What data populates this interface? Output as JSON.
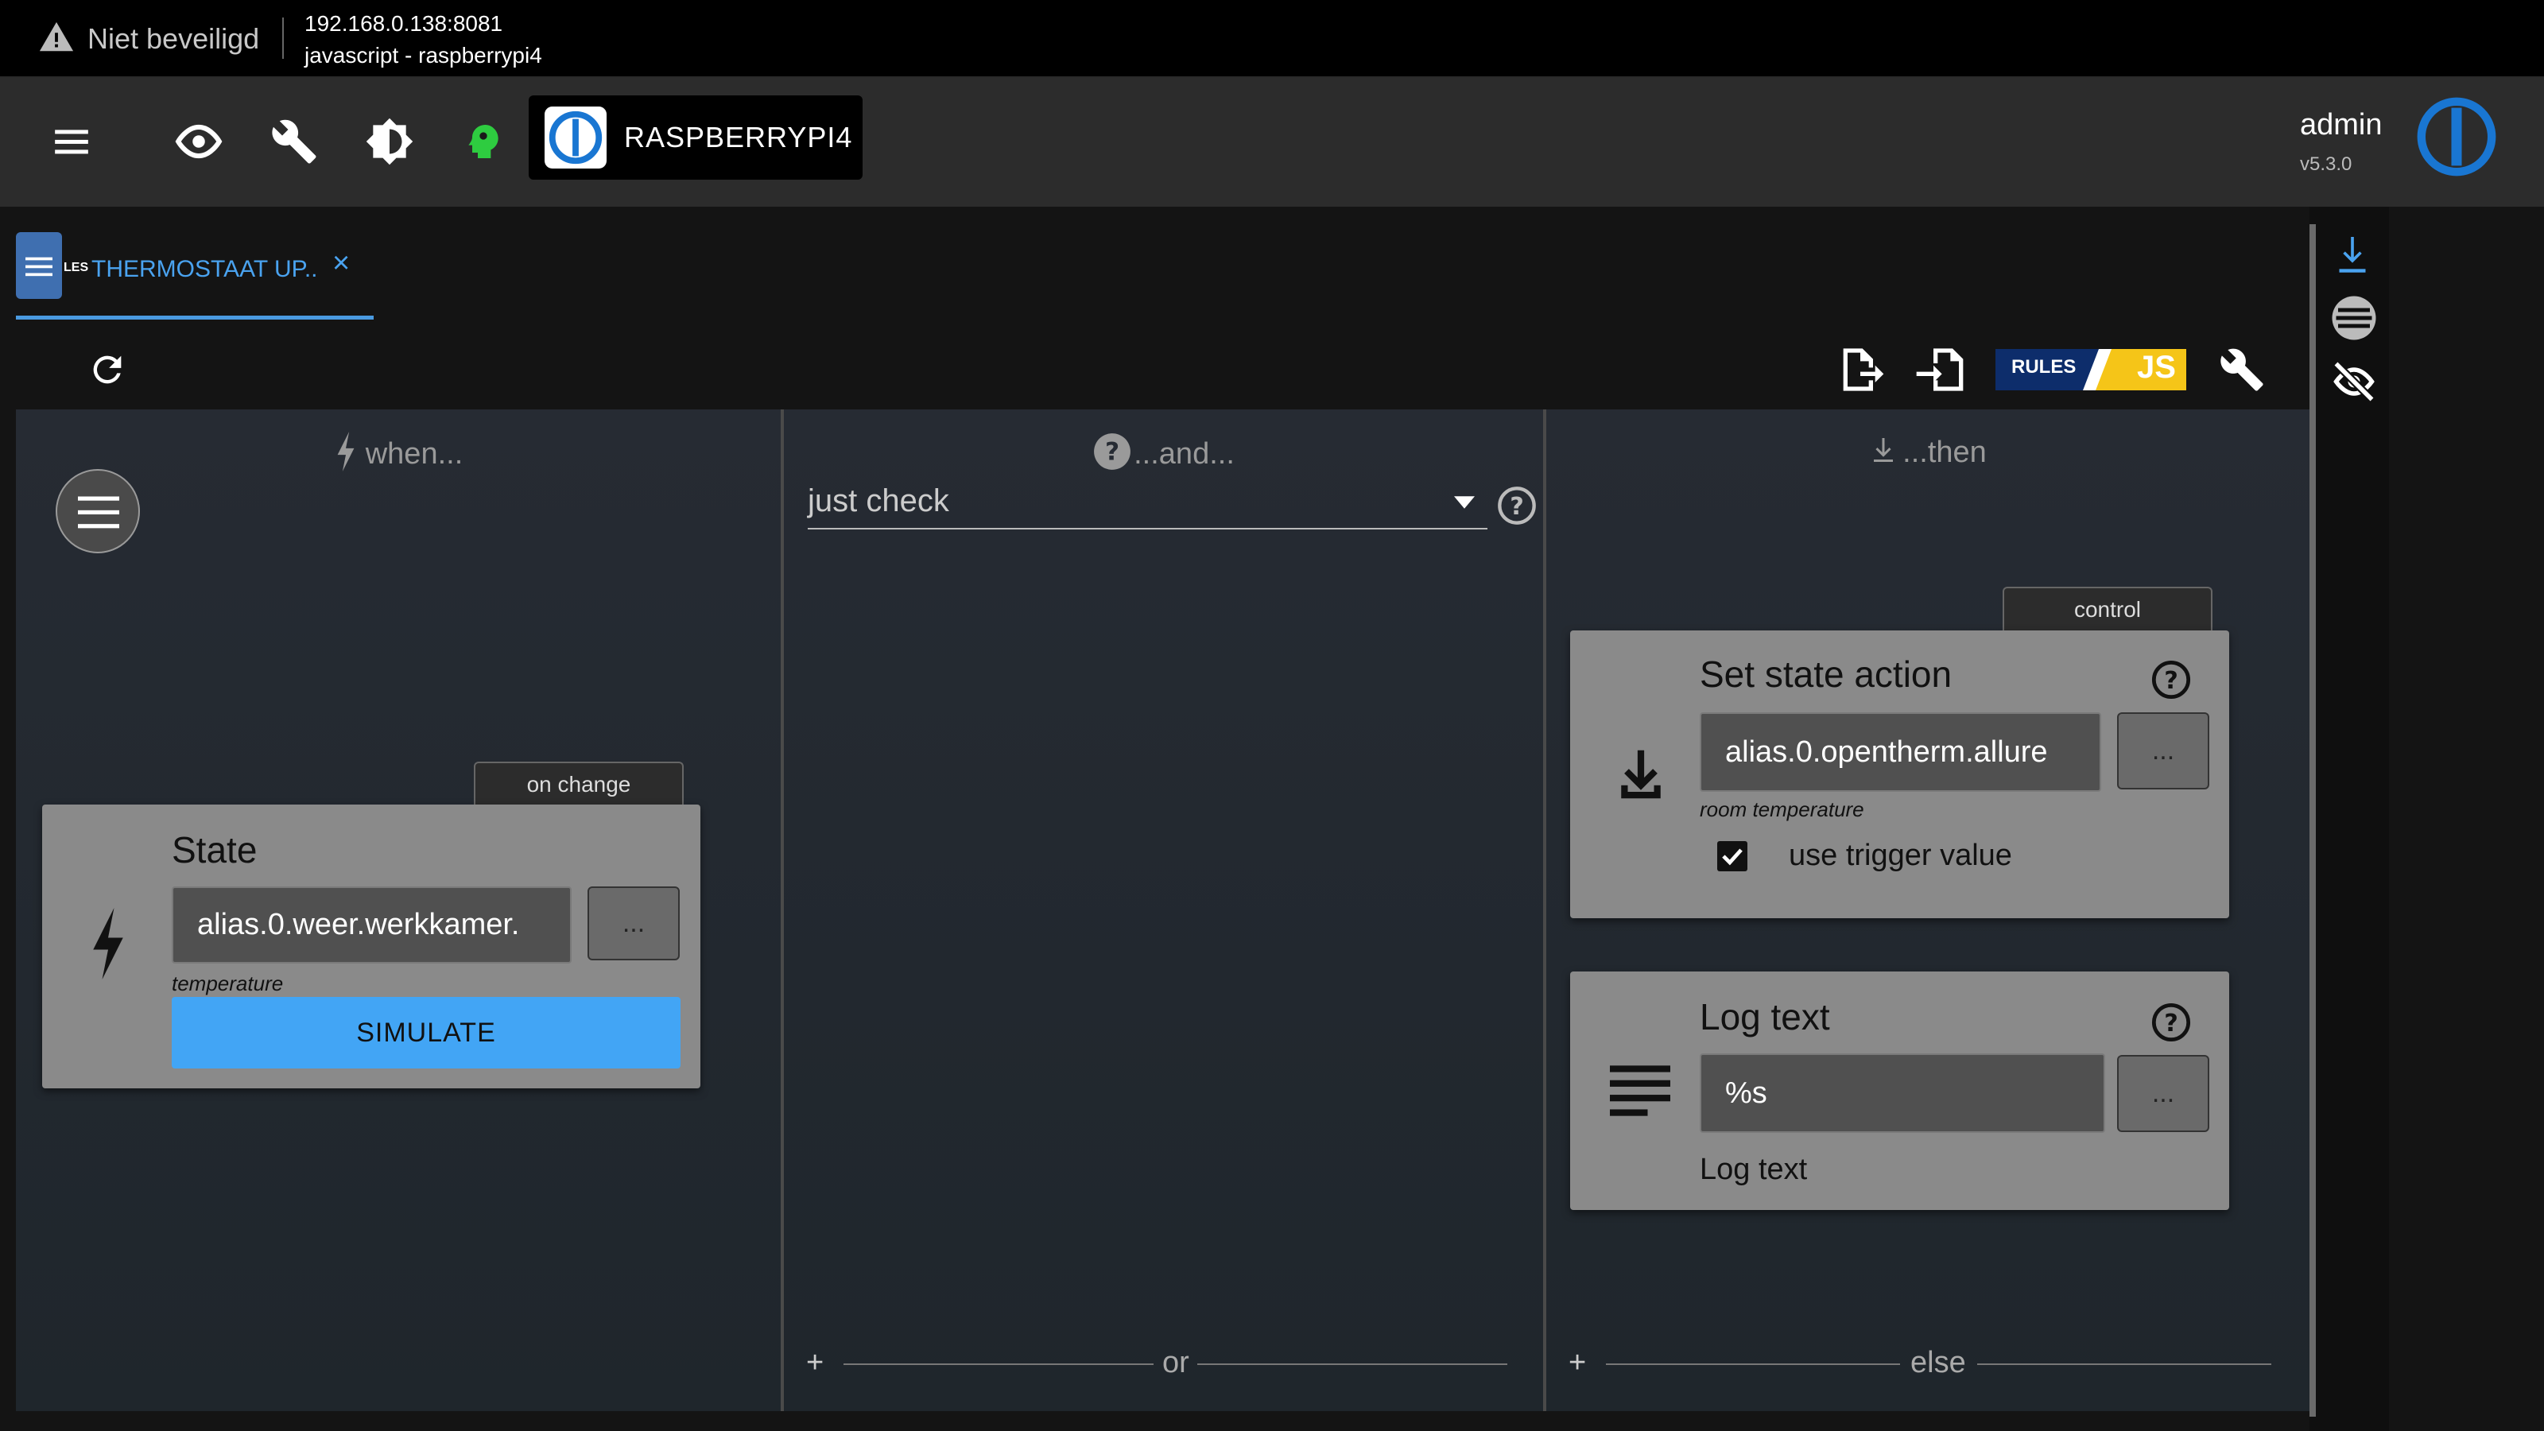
{
  "browser": {
    "security_label": "Niet beveiligd",
    "url": "192.168.0.138:8081",
    "page_title": "javascript - raspberrypi4"
  },
  "appbar": {
    "host_name": "RASPBERRYPI4",
    "user": "admin",
    "version": "v5.3.0",
    "icons": [
      "menu-icon",
      "eye-icon",
      "wrench-icon",
      "brightness-icon",
      "head-icon"
    ]
  },
  "tab": {
    "label": "THERMOSTAAT UP..",
    "badge": "LES",
    "close": "×"
  },
  "toolbar": {
    "rules_label": "RULES",
    "js_label": "JS"
  },
  "columns": {
    "when": {
      "header": "when...",
      "trigger_tag": "on change",
      "card": {
        "title": "State",
        "value": "alias.0.weer.werkkamer.",
        "dots": "...",
        "hint": "temperature",
        "simulate": "SIMULATE"
      }
    },
    "and": {
      "header": "...and...",
      "select_value": "just check",
      "footer": "or",
      "plus": "+"
    },
    "then": {
      "header": "...then",
      "tag": "control",
      "set_state": {
        "title": "Set state action",
        "value": "alias.0.opentherm.allure",
        "dots": "...",
        "hint": "room temperature",
        "checkbox_label": "use trigger value",
        "checked": true
      },
      "log": {
        "title": "Log text",
        "value": "%s",
        "dots": "...",
        "sublabel": "Log text"
      },
      "footer": "else",
      "plus": "+"
    }
  },
  "colors": {
    "accent_blue": "#4aa3f0",
    "simulate_blue": "#42a5f5",
    "green_icon": "#2ecc40",
    "js_yellow": "#f5c518"
  }
}
